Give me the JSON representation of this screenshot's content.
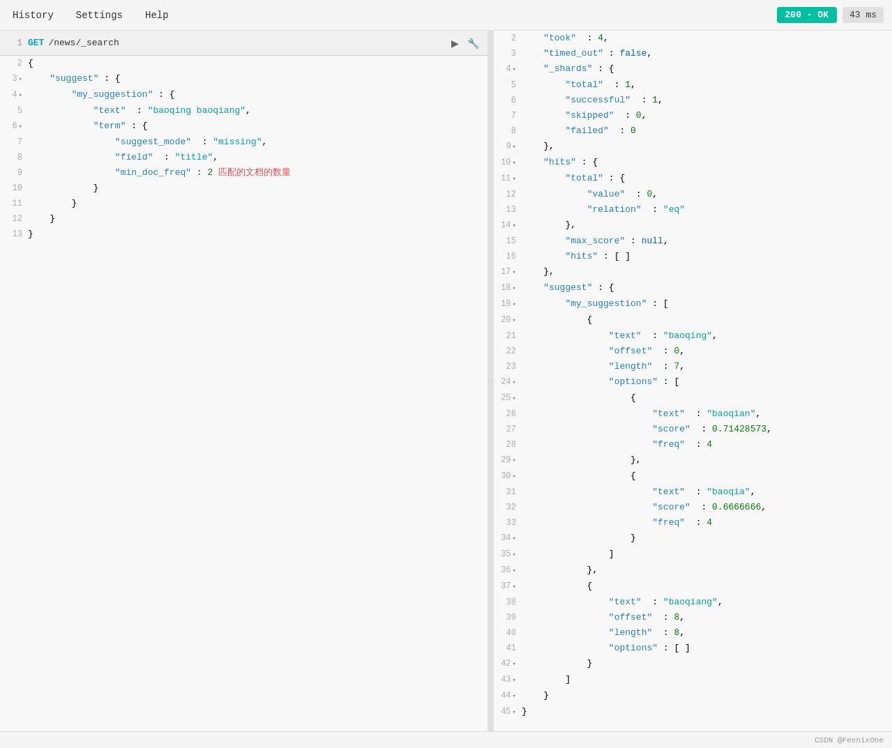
{
  "menuBar": {
    "items": [
      {
        "label": "History",
        "active": false
      },
      {
        "label": "Settings",
        "active": false
      },
      {
        "label": "Help",
        "active": false
      }
    ],
    "status": "200 - OK",
    "time": "43 ms"
  },
  "leftPanel": {
    "requestLine": {
      "lineNumber": "1",
      "method": "GET",
      "url": "/news/_search"
    },
    "codeLines": [
      {
        "ln": "2",
        "toggle": false,
        "content": "{"
      },
      {
        "ln": "3",
        "toggle": true,
        "content": "    \"suggest\": {"
      },
      {
        "ln": "4",
        "toggle": true,
        "content": "        \"my_suggestion\": {"
      },
      {
        "ln": "5",
        "toggle": false,
        "content": "            \"text\": \"baoqing baoqiang\","
      },
      {
        "ln": "6",
        "toggle": true,
        "content": "            \"term\": {"
      },
      {
        "ln": "7",
        "toggle": false,
        "content": "                \"suggest_mode\": \"missing\","
      },
      {
        "ln": "8",
        "toggle": false,
        "content": "                \"field\": \"title\","
      },
      {
        "ln": "9",
        "toggle": false,
        "content": "                \"min_doc_freq\": 2 匹配的文档的数量"
      },
      {
        "ln": "10",
        "toggle": false,
        "content": "            }"
      },
      {
        "ln": "11",
        "toggle": false,
        "content": "        }"
      },
      {
        "ln": "12",
        "toggle": false,
        "content": "    }"
      },
      {
        "ln": "13",
        "toggle": false,
        "content": "}"
      }
    ]
  },
  "rightPanel": {
    "codeLines": [
      {
        "ln": "2",
        "toggle": false,
        "content": "    \"took\" : 4,"
      },
      {
        "ln": "3",
        "toggle": false,
        "content": "    \"timed_out\" : false,"
      },
      {
        "ln": "4",
        "toggle": true,
        "content": "    \"_shards\" : {"
      },
      {
        "ln": "5",
        "toggle": false,
        "content": "        \"total\" : 1,"
      },
      {
        "ln": "6",
        "toggle": false,
        "content": "        \"successful\" : 1,"
      },
      {
        "ln": "7",
        "toggle": false,
        "content": "        \"skipped\" : 0,"
      },
      {
        "ln": "8",
        "toggle": false,
        "content": "        \"failed\" : 0"
      },
      {
        "ln": "9",
        "toggle": true,
        "content": "    },"
      },
      {
        "ln": "10",
        "toggle": true,
        "content": "    \"hits\" : {"
      },
      {
        "ln": "11",
        "toggle": true,
        "content": "        \"total\" : {"
      },
      {
        "ln": "12",
        "toggle": false,
        "content": "            \"value\" : 0,"
      },
      {
        "ln": "13",
        "toggle": false,
        "content": "            \"relation\" : \"eq\""
      },
      {
        "ln": "14",
        "toggle": true,
        "content": "        },"
      },
      {
        "ln": "15",
        "toggle": false,
        "content": "        \"max_score\" : null,"
      },
      {
        "ln": "16",
        "toggle": false,
        "content": "        \"hits\" : [ ]"
      },
      {
        "ln": "17",
        "toggle": true,
        "content": "    },"
      },
      {
        "ln": "18",
        "toggle": true,
        "content": "    \"suggest\" : {"
      },
      {
        "ln": "19",
        "toggle": true,
        "content": "        \"my_suggestion\" : ["
      },
      {
        "ln": "20",
        "toggle": true,
        "content": "            {"
      },
      {
        "ln": "21",
        "toggle": false,
        "content": "                \"text\" : \"baoqing\","
      },
      {
        "ln": "22",
        "toggle": false,
        "content": "                \"offset\" : 0,"
      },
      {
        "ln": "23",
        "toggle": false,
        "content": "                \"length\" : 7,"
      },
      {
        "ln": "24",
        "toggle": true,
        "content": "                \"options\" : ["
      },
      {
        "ln": "25",
        "toggle": true,
        "content": "                    {"
      },
      {
        "ln": "26",
        "toggle": false,
        "content": "                        \"text\" : \"baoqian\","
      },
      {
        "ln": "27",
        "toggle": false,
        "content": "                        \"score\" : 0.71428573,"
      },
      {
        "ln": "28",
        "toggle": false,
        "content": "                        \"freq\" : 4"
      },
      {
        "ln": "29",
        "toggle": true,
        "content": "                    },"
      },
      {
        "ln": "30",
        "toggle": true,
        "content": "                    {"
      },
      {
        "ln": "31",
        "toggle": false,
        "content": "                        \"text\" : \"baoqia\","
      },
      {
        "ln": "32",
        "toggle": false,
        "content": "                        \"score\" : 0.6666666,"
      },
      {
        "ln": "33",
        "toggle": false,
        "content": "                        \"freq\" : 4"
      },
      {
        "ln": "34",
        "toggle": true,
        "content": "                    }"
      },
      {
        "ln": "35",
        "toggle": true,
        "content": "                ]"
      },
      {
        "ln": "36",
        "toggle": true,
        "content": "            },"
      },
      {
        "ln": "37",
        "toggle": true,
        "content": "            {"
      },
      {
        "ln": "38",
        "toggle": false,
        "content": "                \"text\" : \"baoqiang\","
      },
      {
        "ln": "39",
        "toggle": false,
        "content": "                \"offset\" : 8,"
      },
      {
        "ln": "40",
        "toggle": false,
        "content": "                \"length\" : 8,"
      },
      {
        "ln": "41",
        "toggle": false,
        "content": "                \"options\" : [ ]"
      },
      {
        "ln": "42",
        "toggle": true,
        "content": "            }"
      },
      {
        "ln": "43",
        "toggle": true,
        "content": "        ]"
      },
      {
        "ln": "44",
        "toggle": true,
        "content": "    }"
      },
      {
        "ln": "45",
        "toggle": true,
        "content": "}"
      }
    ]
  },
  "footer": {
    "credit": "CSDN @FeenixOne"
  }
}
